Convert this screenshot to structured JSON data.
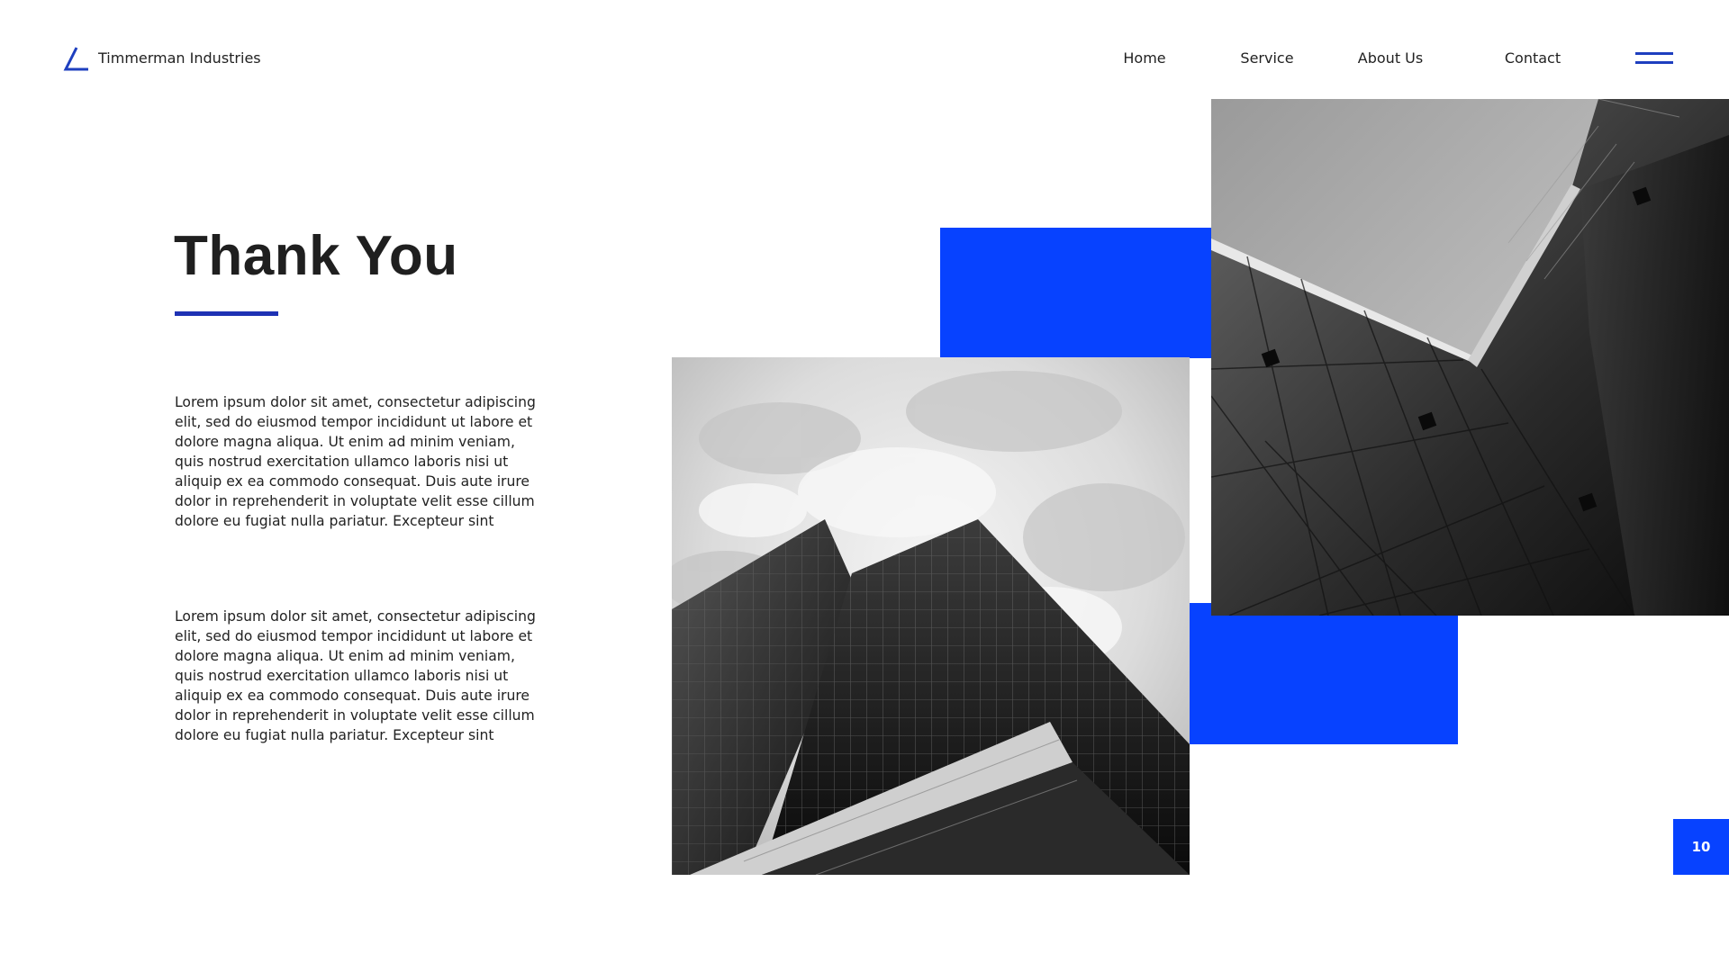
{
  "header": {
    "brand_name": "Timmerman Industries",
    "logo_icon": "triangle-logo-icon",
    "nav": [
      {
        "label": "Home"
      },
      {
        "label": "Service"
      },
      {
        "label": "About Us"
      },
      {
        "label": "Contact"
      }
    ],
    "menu_icon": "hamburger-menu-icon"
  },
  "main": {
    "title": "Thank You",
    "paragraphs": [
      "Lorem ipsum dolor sit amet, consectetur adipiscing elit, sed do eiusmod tempor incididunt ut labore et dolore magna aliqua. Ut enim ad minim veniam, quis nostrud exercitation ullamco laboris nisi ut aliquip ex ea commodo consequat. Duis aute irure dolor in reprehenderit in voluptate velit esse cillum dolore eu fugiat nulla pariatur. Excepteur sint",
      "Lorem ipsum dolor sit amet, consectetur adipiscing elit, sed do eiusmod tempor incididunt ut labore et dolore magna aliqua. Ut enim ad minim veniam, quis nostrud exercitation ullamco laboris nisi ut aliquip ex ea commodo consequat. Duis aute irure dolor in reprehenderit in voluptate velit esse cillum dolore eu fugiat nulla pariatur. Excepteur sint"
    ]
  },
  "images": {
    "left": "skyscraper-photo",
    "right": "modern-building-photo"
  },
  "footer": {
    "page_number": "10"
  },
  "colors": {
    "accent_blue": "#0742ff",
    "underline_blue": "#1e32b4",
    "text_dark": "#1f1f1f"
  }
}
